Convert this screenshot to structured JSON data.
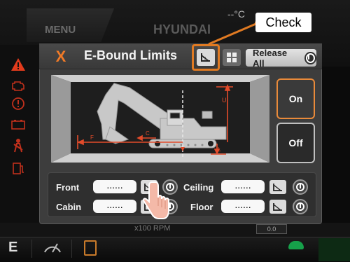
{
  "background": {
    "menu_label": "MENU",
    "brand": "HYUNDAI",
    "temperature": "--°C",
    "rpm_label": "x100 RPM",
    "readout": "0.0",
    "gear_label": "E"
  },
  "dialog": {
    "close_label": "X",
    "title": "E-Bound Limits",
    "release_all_label": "Release All",
    "on_label": "On",
    "off_label": "Off"
  },
  "diagram": {
    "labels": {
      "front": "F",
      "ceiling": "U",
      "cabin": "C",
      "floor": "L"
    }
  },
  "limits": {
    "front": {
      "label": "Front",
      "value": "......"
    },
    "ceiling": {
      "label": "Ceiling",
      "value": "......"
    },
    "cabin": {
      "label": "Cabin",
      "value": "......"
    },
    "floor": {
      "label": "Floor",
      "value": "......"
    }
  },
  "annotation": {
    "callout": "Check"
  },
  "colors": {
    "accent": "#e98a3a",
    "close": "#f07a27",
    "highlight": "#e07a22",
    "limit_line": "#e34b2a"
  },
  "icons": [
    "set-limit-icon",
    "grid-icon",
    "power-icon",
    "warning-icon",
    "hand-pointer-icon",
    "turtle-icon",
    "wiper-icon",
    "lock-icon"
  ]
}
